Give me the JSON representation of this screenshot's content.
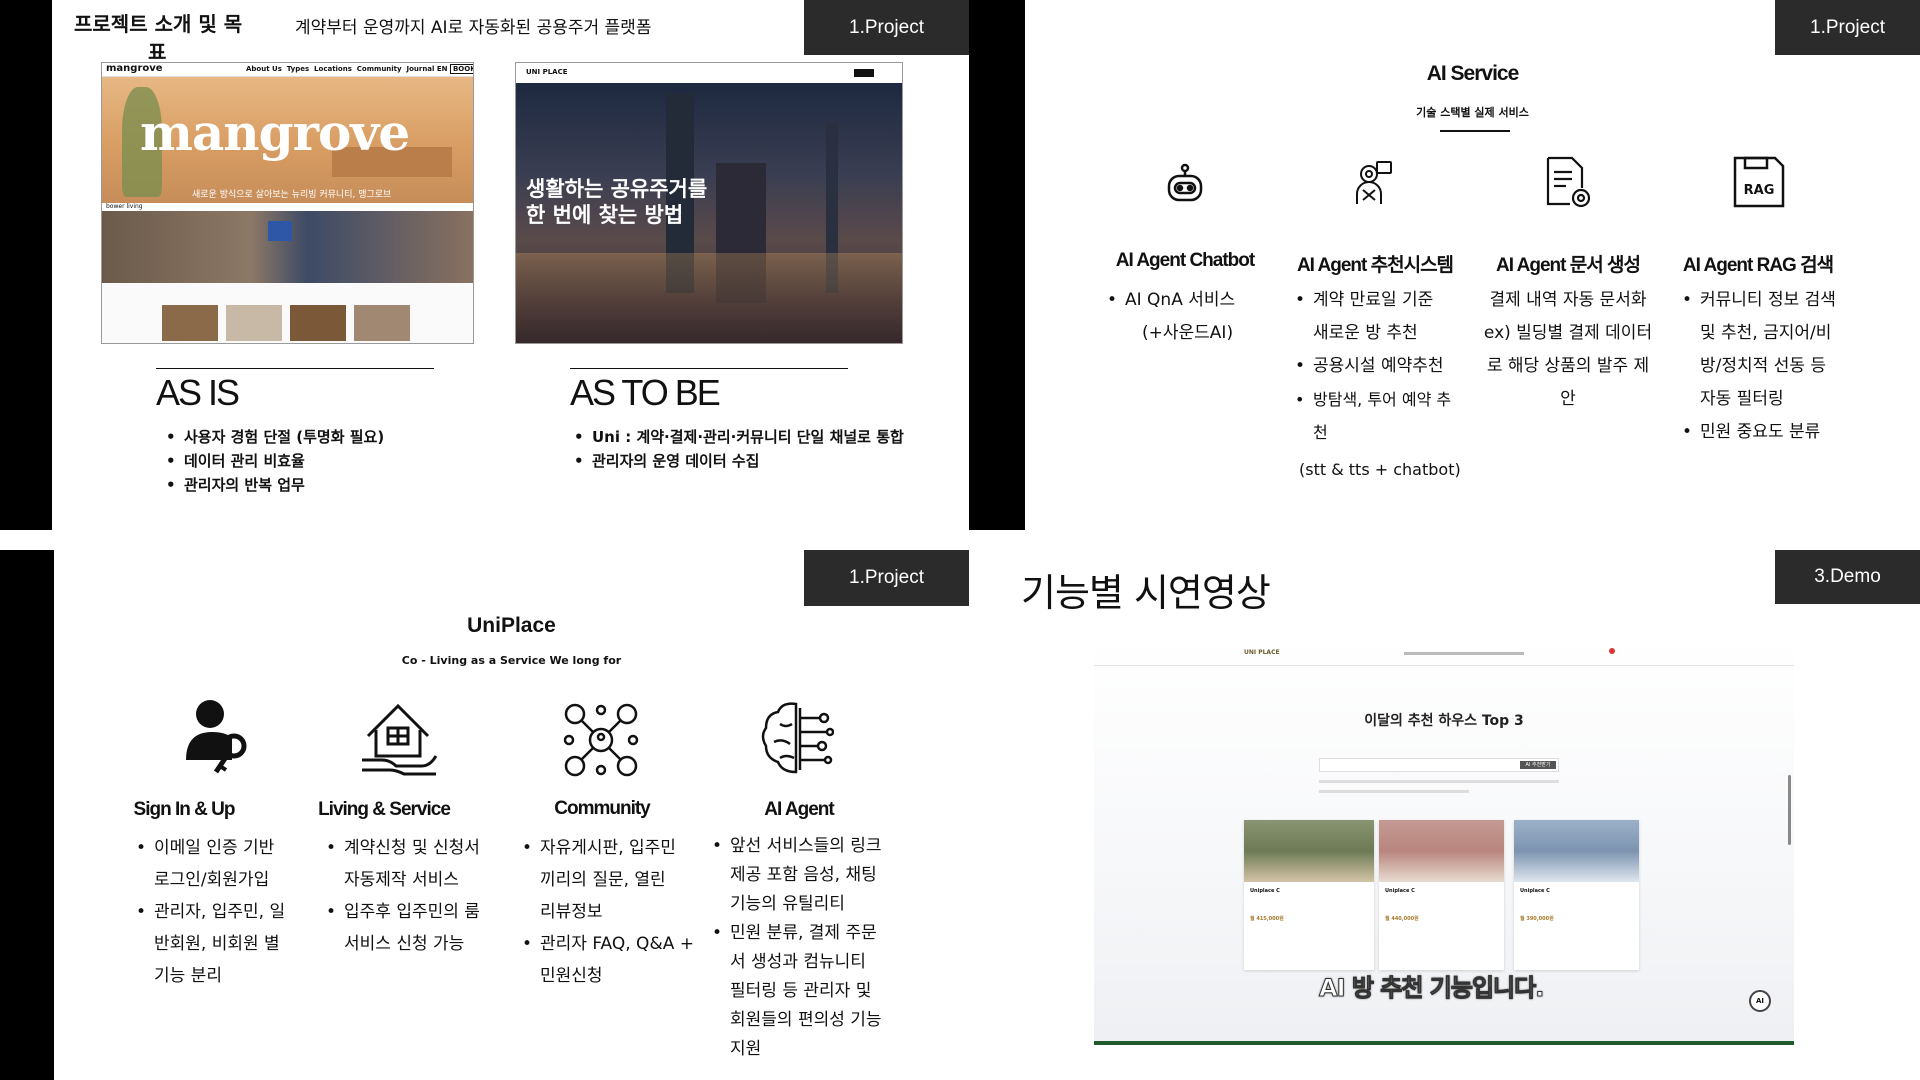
{
  "colors": {
    "dark_tag": "#2b2b2b",
    "side_bar": "#000000",
    "demo_line": "#1f5a2c"
  },
  "panel1": {
    "title_line1": "프로젝트 소개 및 목",
    "title_line2": "표",
    "subtitle": "계약부터 운영까지 AI로 자동화된 공용주거 플랫폼",
    "tag": "1.Project",
    "mangrove": {
      "logo": "mangrove",
      "nav": [
        "About Us",
        "Types",
        "Locations",
        "Community",
        "Journal",
        "EN",
        "BOOK"
      ],
      "hero_word": "mangrove",
      "hero_caption": "새로운 방식으로 살아보는 뉴리빙 커뮤니티, 맹그로브",
      "brand2": "bower living"
    },
    "uniplace_shot": {
      "logo": "UNI PLACE",
      "headline_1": "생활하는 공유주거를",
      "headline_2": "한 번에 찾는 방법"
    },
    "as_is": {
      "heading": "AS IS",
      "items": [
        "사용자 경험 단절 (투명화 필요)",
        "데이터 관리 비효율",
        "관리자의 반복 업무"
      ]
    },
    "as_to_be": {
      "heading": "AS TO BE",
      "items": [
        "Uni : 계약·결제·관리·커뮤니티 단일 채널로 통합",
        "관리자의  운영 데이터 수집"
      ]
    }
  },
  "panel2": {
    "tag": "1.Project",
    "title": "AI Service",
    "subtitle": "기술 스택별 실제 서비스",
    "columns": [
      {
        "icon": "robot-icon",
        "heading": "AI Agent Chatbot",
        "bullets": [
          [
            "AI QnA 서비스",
            "(+사운드AI)"
          ]
        ],
        "note": []
      },
      {
        "icon": "ai-person-icon",
        "heading": "AI Agent 추천시스템",
        "bullets": [
          [
            "계약 만료일 기준",
            "새로운 방 추천"
          ],
          [
            "공용시설 예약추천"
          ],
          [
            "방탐색, 투어 예약 추",
            "천"
          ]
        ],
        "note": [
          "(stt & tts + chatbot)"
        ]
      },
      {
        "icon": "document-gear-icon",
        "heading": "AI Agent 문서 생성",
        "bullets": [],
        "note": [
          "결제 내역 자동 문서화",
          "ex) 빌딩별 결제 데이터",
          "로 해당 상품의 발주 제",
          "안"
        ]
      },
      {
        "icon": "rag-disk-icon",
        "heading": "AI Agent RAG 검색",
        "bullets": [
          [
            "커뮤니티 정보 검색",
            "및 추천, 금지어/비",
            "방/정치적 선동 등",
            "자동 필터링"
          ],
          [
            "민원 중요도 분류"
          ]
        ],
        "note": []
      }
    ],
    "rag_label": "RAG"
  },
  "panel3": {
    "tag": "1.Project",
    "title": "UniPlace",
    "subtitle": "Co - Living as a Service We long for",
    "columns": [
      {
        "icon": "user-key-icon",
        "heading": "Sign In & Up",
        "bullets": [
          [
            "이메일 인증 기반",
            "로그인/회원가입"
          ],
          [
            "관리자, 입주민, 일",
            "반회원, 비회원 별",
            "기능 분리"
          ]
        ]
      },
      {
        "icon": "house-hand-icon",
        "heading": "Living & Service",
        "bullets": [
          [
            "계약신청 및 신청서",
            "자동제작 서비스"
          ],
          [
            "입주후 입주민의 룸",
            "서비스 신청 가능"
          ]
        ]
      },
      {
        "icon": "community-icon",
        "heading": "Community",
        "bullets": [
          [
            "자유게시판, 입주민",
            "끼리의 질문, 열린",
            "리뷰정보"
          ],
          [
            "관리자 FAQ, Q&A +",
            "민원신청"
          ]
        ]
      },
      {
        "icon": "brain-circuit-icon",
        "heading": "AI Agent",
        "bullets": [
          [
            "앞선 서비스들의 링크",
            "제공 포함 음성, 채팅",
            "기능의 유틸리티"
          ],
          [
            "민원 분류, 결제 주문",
            "서 생성과 컴뉴니티",
            "필터링 등 관리자 및",
            "회원들의 편의성 기능",
            "지원"
          ]
        ]
      }
    ]
  },
  "panel4": {
    "tag": "3.Demo",
    "title": "기능별 시연영상",
    "demo": {
      "logo": "UNI PLACE",
      "heading": "이달의 추천 하우스 Top 3",
      "search_button": "AI 추천받기",
      "cards": [
        {
          "name": "Uniplace C",
          "price": "월 415,000원"
        },
        {
          "name": "Uniplace C",
          "price": "월 440,000원"
        },
        {
          "name": "Uniplace C",
          "price": "월 390,000원"
        }
      ],
      "caption": "AI 방 추천 기능입니다.",
      "ai_badge": "AI"
    }
  }
}
